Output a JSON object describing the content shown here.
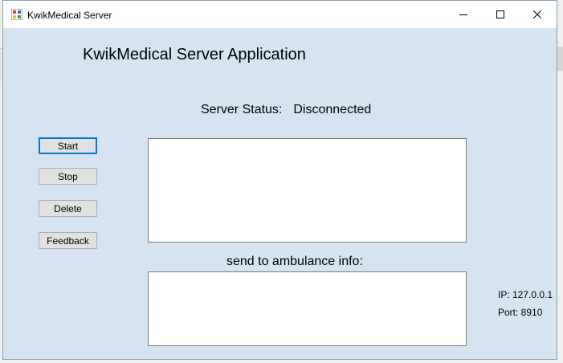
{
  "window": {
    "title": "KwikMedical Server"
  },
  "titlebar": {
    "minimize_icon": "minimize-icon",
    "maximize_icon": "maximize-icon",
    "close_icon": "close-icon"
  },
  "main": {
    "heading": "KwikMedical Server Application",
    "status_label": "Server Status:",
    "status_value": "Disconnected",
    "buttons": {
      "start": "Start",
      "stop": "Stop",
      "delete": "Delete",
      "feedback": "Feedback"
    },
    "log_text": "",
    "ambulance_label": "send to ambulance info:",
    "ambulance_text": "",
    "ip": "IP: 127.0.0.1",
    "port": "Port: 8910"
  },
  "colors": {
    "window_bg": "#d6e4f2",
    "accent": "#0078d7"
  }
}
